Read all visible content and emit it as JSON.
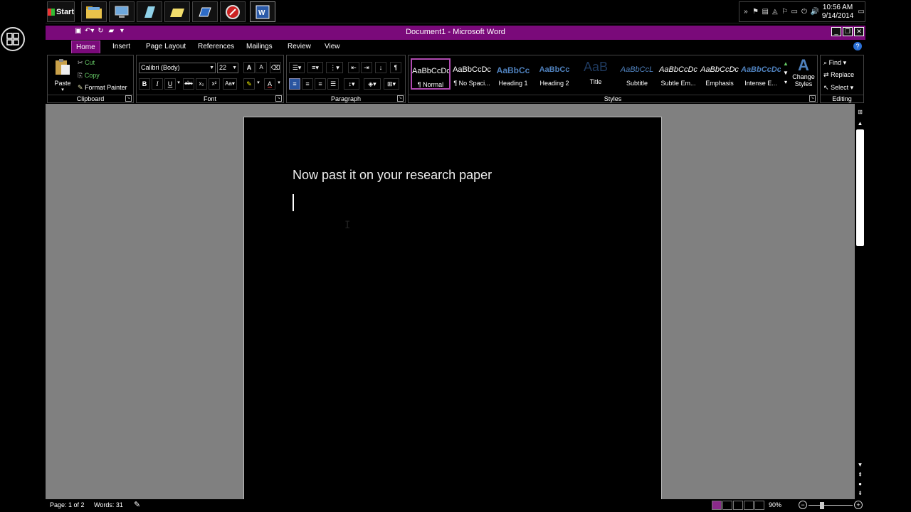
{
  "taskbar": {
    "start_label": "Start",
    "clock_time": "10:56 AM",
    "clock_date": "9/14/2014"
  },
  "titlebar": {
    "title": "Document1 - Microsoft Word"
  },
  "tabs": [
    {
      "label": "Home",
      "active": true
    },
    {
      "label": "Insert"
    },
    {
      "label": "Page Layout"
    },
    {
      "label": "References"
    },
    {
      "label": "Mailings"
    },
    {
      "label": "Review"
    },
    {
      "label": "View"
    }
  ],
  "clipboard": {
    "paste": "Paste",
    "cut": "Cut",
    "copy": "Copy",
    "format_painter": "Format Painter",
    "label": "Clipboard"
  },
  "font": {
    "family": "Calibri (Body)",
    "size": "22",
    "label": "Font",
    "bold": "B",
    "italic": "I",
    "underline": "U",
    "strike": "abc"
  },
  "paragraph": {
    "label": "Paragraph",
    "show_marks": "¶"
  },
  "styles": {
    "label": "Styles",
    "tiles": [
      {
        "preview": "AaBbCcDc",
        "name": "¶ Normal",
        "selected": true
      },
      {
        "preview": "AaBbCcDc",
        "name": "¶ No Spaci..."
      },
      {
        "preview": "AaBbCc",
        "name": "Heading 1"
      },
      {
        "preview": "AaBbCc",
        "name": "Heading 2"
      },
      {
        "preview": "AaB",
        "name": "Title"
      },
      {
        "preview": "AaBbCcL",
        "name": "Subtitle"
      },
      {
        "preview": "AaBbCcDc",
        "name": "Subtle Em..."
      },
      {
        "preview": "AaBbCcDc",
        "name": "Emphasis"
      },
      {
        "preview": "AaBbCcDc",
        "name": "Intense E..."
      }
    ],
    "change_styles_line1": "Change",
    "change_styles_line2": "Styles"
  },
  "editing": {
    "label": "Editing",
    "find": "Find",
    "replace": "Replace",
    "select": "Select"
  },
  "document": {
    "text": "Now past it on your research paper"
  },
  "statusbar": {
    "page": "Page: 1 of 2",
    "words": "Words: 31",
    "zoom": "90%",
    "zoom_level": 0.3
  },
  "colors": {
    "accent": "#7a0a7a",
    "workspace": "#808080"
  }
}
